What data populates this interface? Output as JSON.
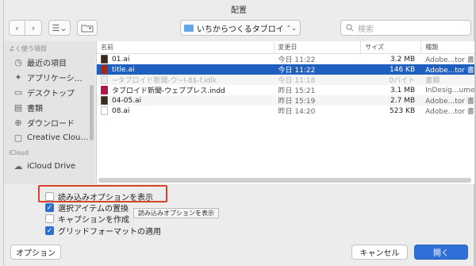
{
  "window": {
    "title": "配置"
  },
  "toolbar": {
    "back_icon": "‹",
    "forward_icon": "›",
    "view_icon": "☰⌄",
    "location": "いちからつくるタブロイド新聞",
    "location_arrows": "⌃⌄",
    "search_placeholder": "検索"
  },
  "sidebar": {
    "favorites_header": "よく使う項目",
    "favorites": [
      {
        "label": "最近の項目",
        "icon": "recents-icon",
        "glyph": "◷"
      },
      {
        "label": "アプリケーシ…",
        "icon": "applications-icon",
        "glyph": "✦"
      },
      {
        "label": "デスクトップ",
        "icon": "desktop-icon",
        "glyph": "▭"
      },
      {
        "label": "書類",
        "icon": "documents-icon",
        "glyph": "▤"
      },
      {
        "label": "ダウンロード",
        "icon": "downloads-icon",
        "glyph": "⊕"
      },
      {
        "label": "Creative Clou…",
        "icon": "folder-icon",
        "glyph": "▢"
      }
    ],
    "icloud_header": "iCloud",
    "icloud": [
      {
        "label": "iCloud Drive",
        "icon": "cloud-icon",
        "glyph": "☁"
      }
    ]
  },
  "file_list": {
    "columns": {
      "name": "名前",
      "date": "変更日",
      "size": "サイズ",
      "kind": "種類"
    },
    "rows": [
      {
        "name": "01.ai",
        "date": "今日 11:22",
        "size": "3.2 MB",
        "kind": "Adobe...tor 書類",
        "icon": "ai",
        "state": "normal"
      },
      {
        "name": "title.ai",
        "date": "今日 11:22",
        "size": "146 KB",
        "kind": "Adobe...tor 書類",
        "icon": "ai-red",
        "state": "selected"
      },
      {
        "name": "~タブロイド新聞-ウ~l-8$-f.idlk",
        "date": "今日 11:18",
        "size": "0バイト",
        "kind": "書類",
        "icon": "blank",
        "state": "dimmed"
      },
      {
        "name": "タブロイド新聞-ウェブプレス.indd",
        "date": "昨日 15:21",
        "size": "3.1 MB",
        "kind": "InDesig...ument",
        "icon": "indd",
        "state": "normal"
      },
      {
        "name": "04-05.ai",
        "date": "昨日 15:19",
        "size": "2.7 MB",
        "kind": "Adobe...tor 書類",
        "icon": "ai",
        "state": "normal"
      },
      {
        "name": "08.ai",
        "date": "昨日 14:20",
        "size": "523 KB",
        "kind": "Adobe...tor 書類",
        "icon": "pdf",
        "state": "normal"
      }
    ]
  },
  "import_options": {
    "show_import_options": {
      "label": "読み込みオプションを表示",
      "checked": false
    },
    "replace_selected": {
      "label": "選択アイテムの置換",
      "checked": true
    },
    "create_captions": {
      "label": "キャプションを作成",
      "checked": false
    },
    "apply_grid_format": {
      "label": "グリッドフォーマットの適用",
      "checked": true
    },
    "tooltip": "読み込みオプションを表示"
  },
  "footer": {
    "options_label": "オプション",
    "cancel_label": "キャンセル",
    "open_label": "開く"
  },
  "colors": {
    "accent": "#2f6fd8",
    "selection": "#1f5fbf",
    "highlight_box": "#d9432b"
  }
}
